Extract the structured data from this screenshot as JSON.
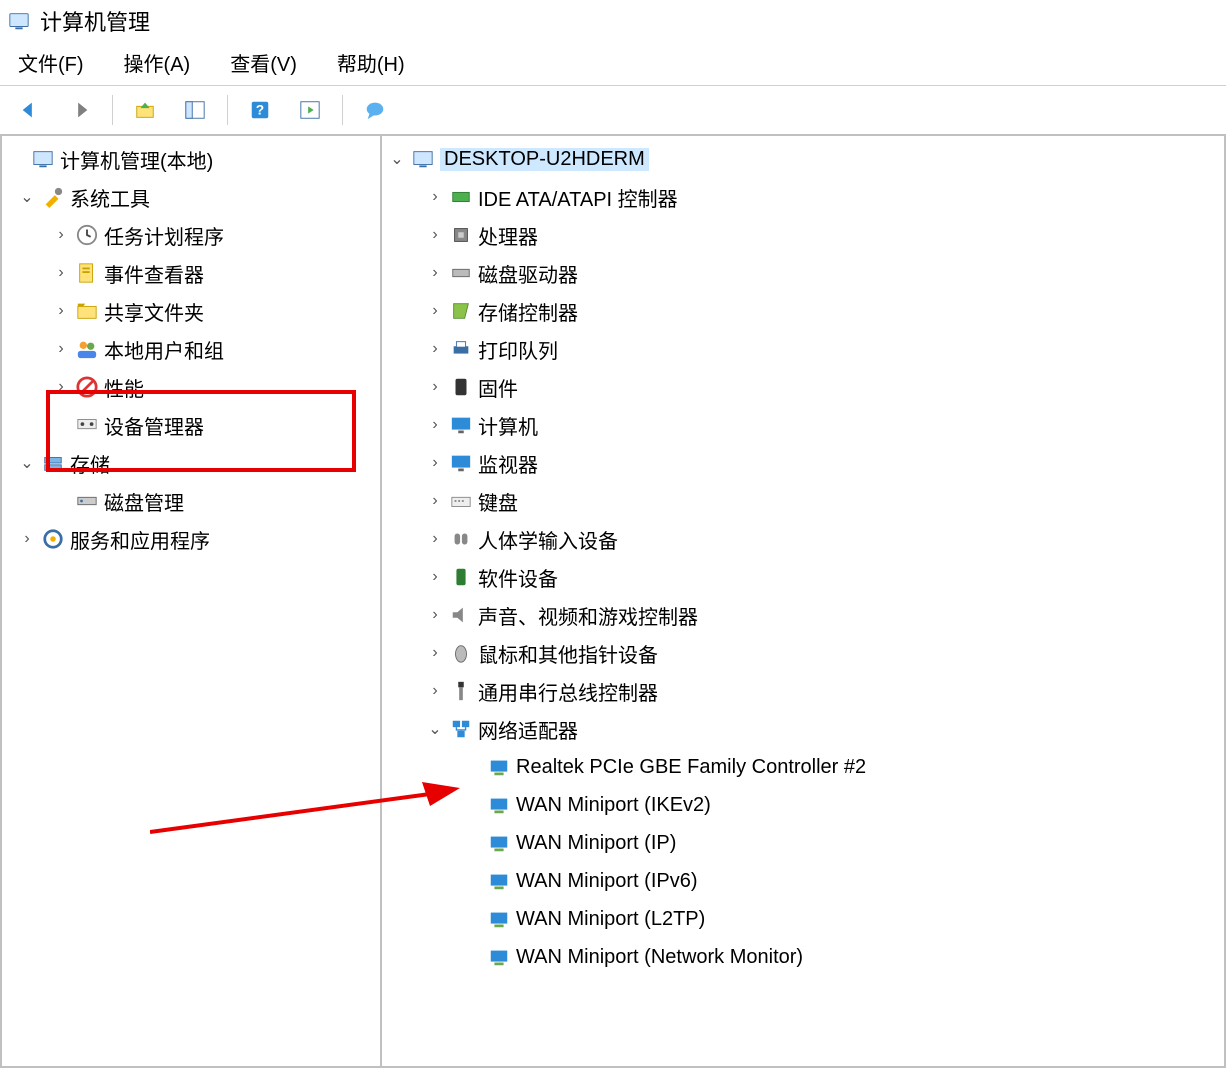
{
  "window": {
    "title": "计算机管理"
  },
  "menus": {
    "file": "文件(F)",
    "action": "操作(A)",
    "view": "查看(V)",
    "help": "帮助(H)"
  },
  "toolbar_icons": {
    "back": "back-arrow-icon",
    "forward": "forward-arrow-icon",
    "up": "up-folder-icon",
    "panel": "toggle-panel-icon",
    "help": "help-icon",
    "refresh": "refresh-icon",
    "search": "speech-icon"
  },
  "left_tree": {
    "root": "计算机管理(本地)",
    "system_tools": {
      "label": "系统工具",
      "children": {
        "task_scheduler": "任务计划程序",
        "event_viewer": "事件查看器",
        "shared_folders": "共享文件夹",
        "local_users": "本地用户和组",
        "performance": "性能",
        "device_manager": "设备管理器"
      }
    },
    "storage": {
      "label": "存储",
      "children": {
        "disk_mgmt": "磁盘管理"
      }
    },
    "services_apps": "服务和应用程序"
  },
  "right_tree": {
    "computer": "DESKTOP-U2HDERM",
    "categories": {
      "ide": "IDE ATA/ATAPI 控制器",
      "cpu": "处理器",
      "disk": "磁盘驱动器",
      "storage_ctrl": "存储控制器",
      "print": "打印队列",
      "firmware": "固件",
      "computers": "计算机",
      "monitor": "监视器",
      "keyboard": "键盘",
      "hid": "人体学输入设备",
      "softdev": "软件设备",
      "sound": "声音、视频和游戏控制器",
      "mouse": "鼠标和其他指针设备",
      "usb": "通用串行总线控制器",
      "netadapter": "网络适配器"
    },
    "netadapters": {
      "realtek": "Realtek PCIe GBE Family Controller #2",
      "wan1": "WAN Miniport (IKEv2)",
      "wan2": "WAN Miniport (IP)",
      "wan3": "WAN Miniport (IPv6)",
      "wan4": "WAN Miniport (L2TP)",
      "wan5": "WAN Miniport (Network Monitor)"
    }
  },
  "annotations": {
    "highlight": "device-manager",
    "arrow_target": "realtek-adapter"
  }
}
